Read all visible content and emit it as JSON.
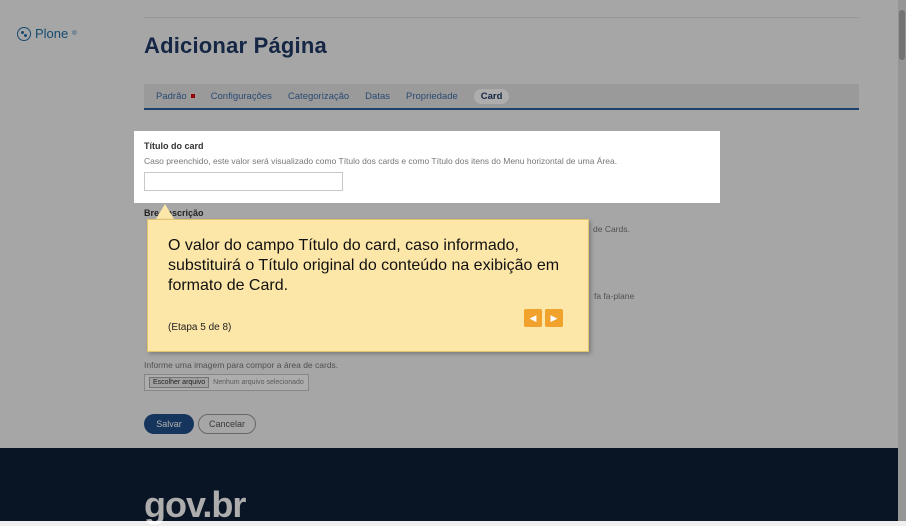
{
  "logo": {
    "text": "Plone",
    "mark": "®"
  },
  "page_title": "Adicionar Página",
  "tabs": [
    {
      "label": "Padrão",
      "required": true
    },
    {
      "label": "Configurações"
    },
    {
      "label": "Categorização"
    },
    {
      "label": "Datas"
    },
    {
      "label": "Propriedade"
    },
    {
      "label": "Card",
      "active": true
    }
  ],
  "fields": {
    "card_title": {
      "label": "Título do card",
      "help": "Caso preenchido, este valor será visualizado como Título dos cards e como Título dos itens do Menu horizontal de uma Área.",
      "value": ""
    },
    "short_desc": {
      "label": "Bre   descrição",
      "help_partial": "de Cards."
    },
    "icon_partial": "fa fa-plane",
    "image_help": "Informe uma imagem para compor a área de cards.",
    "file_button": "Escolher arquivo",
    "file_status": "Nenhum arquivo selecionado"
  },
  "buttons": {
    "save": "Salvar",
    "cancel": "Cancelar"
  },
  "footer": {
    "brand": "gov.br"
  },
  "tour": {
    "text": "O valor do campo Título do card, caso informado, substituirá o Título original do conteúdo na exibição em formato de Card.",
    "step": "(Etapa 5 de 8)",
    "prev_icon": "chevron-left-icon",
    "next_icon": "chevron-right-icon",
    "accent": "#f0a22c",
    "bg": "#fce6a8"
  }
}
